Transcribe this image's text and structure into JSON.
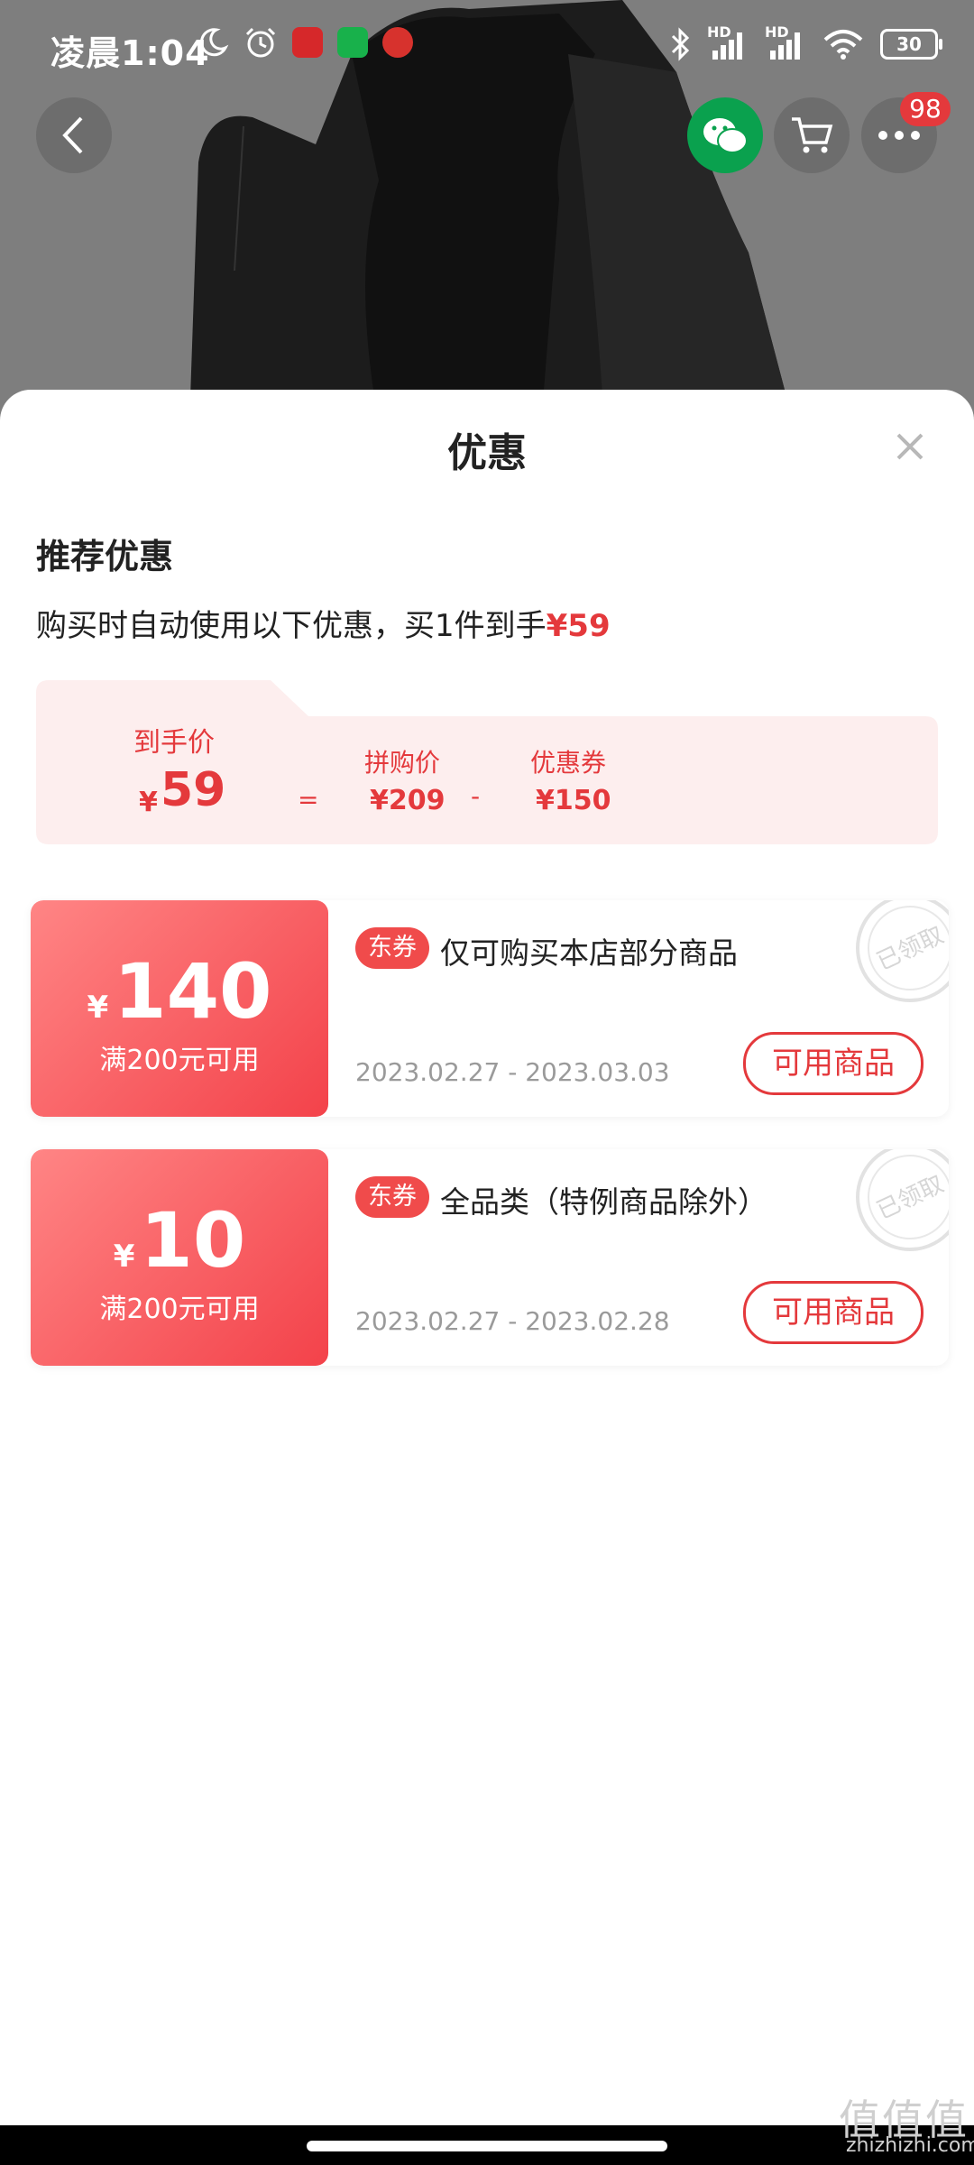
{
  "status_bar": {
    "time": "凌晨1:04",
    "battery": "30",
    "signal_1": "HD",
    "signal_2": "HD"
  },
  "top_nav": {
    "cart_badge_count": "98"
  },
  "sheet": {
    "title": "优惠",
    "section_title": "推荐优惠",
    "desc_prefix": "购买时自动使用以下优惠，买1件到手",
    "desc_price": "¥59"
  },
  "breakdown": {
    "final_label": "到手价",
    "final_yen": "¥",
    "final_value": "59",
    "equals": "=",
    "group_label": "拼购价",
    "group_value": "¥209",
    "minus": "-",
    "coupon_label": "优惠券",
    "coupon_value": "¥150"
  },
  "coupons": [
    {
      "yen": "¥",
      "amount": "140",
      "condition": "满200元可用",
      "tag": "东券",
      "description": "仅可购买本店部分商品",
      "date": "2023.02.27 - 2023.03.03",
      "button": "可用商品",
      "stamp": "已领取"
    },
    {
      "yen": "¥",
      "amount": "10",
      "condition": "满200元可用",
      "tag": "东券",
      "description": "全品类（特例商品除外）",
      "date": "2023.02.27 - 2023.02.28",
      "button": "可用商品",
      "stamp": "已领取"
    }
  ],
  "watermark": {
    "logo": "值值值",
    "site": "zhizhizhi.com"
  },
  "colors": {
    "accent_red": "#e4393c",
    "wechat_green": "#0aa14e"
  }
}
